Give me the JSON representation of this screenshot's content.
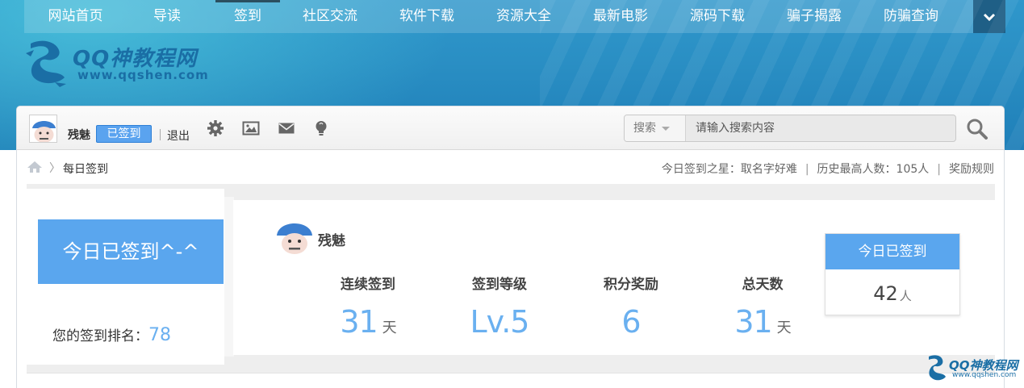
{
  "nav": {
    "items": [
      "网站首页",
      "导读",
      "签到",
      "社区交流",
      "软件下载",
      "资源大全",
      "最新电影",
      "源码下载",
      "骗子揭露",
      "防骗查询"
    ],
    "active_index": 2,
    "more_icon": "chevron-down-icon"
  },
  "logo": {
    "title": "QQ神教程网",
    "url": "www.qqshen.com"
  },
  "user": {
    "name": "残魅",
    "signed_badge": "已签到",
    "logout": "退出"
  },
  "toolbar_icons": [
    "gear-icon",
    "image-icon",
    "mail-icon",
    "lightbulb-icon"
  ],
  "search": {
    "type_label": "搜索",
    "placeholder": "请输入搜索内容"
  },
  "breadcrumb": {
    "current": "每日签到"
  },
  "stats": {
    "star": "今日签到之星：取名字好难",
    "max": "历史最高人数：105人",
    "rules": "奖励规则"
  },
  "sign": {
    "big_label": "今日已签到^-^",
    "rank_label": "您的签到排名：",
    "rank_value": "78",
    "username": "残魅",
    "columns": [
      {
        "label": "连续签到",
        "value": "31",
        "unit": "天"
      },
      {
        "label": "签到等级",
        "value": "Lv.5",
        "unit": ""
      },
      {
        "label": "积分奖励",
        "value": "6",
        "unit": ""
      },
      {
        "label": "总天数",
        "value": "31",
        "unit": "天"
      }
    ],
    "today_head": "今日已签到",
    "today_count": "42",
    "today_unit": "人"
  },
  "watermark": {
    "title": "QQ神教程网",
    "url": "www.qqshen.com"
  },
  "colors": {
    "accent": "#5aa6ee",
    "header": "#2a8fc4"
  }
}
